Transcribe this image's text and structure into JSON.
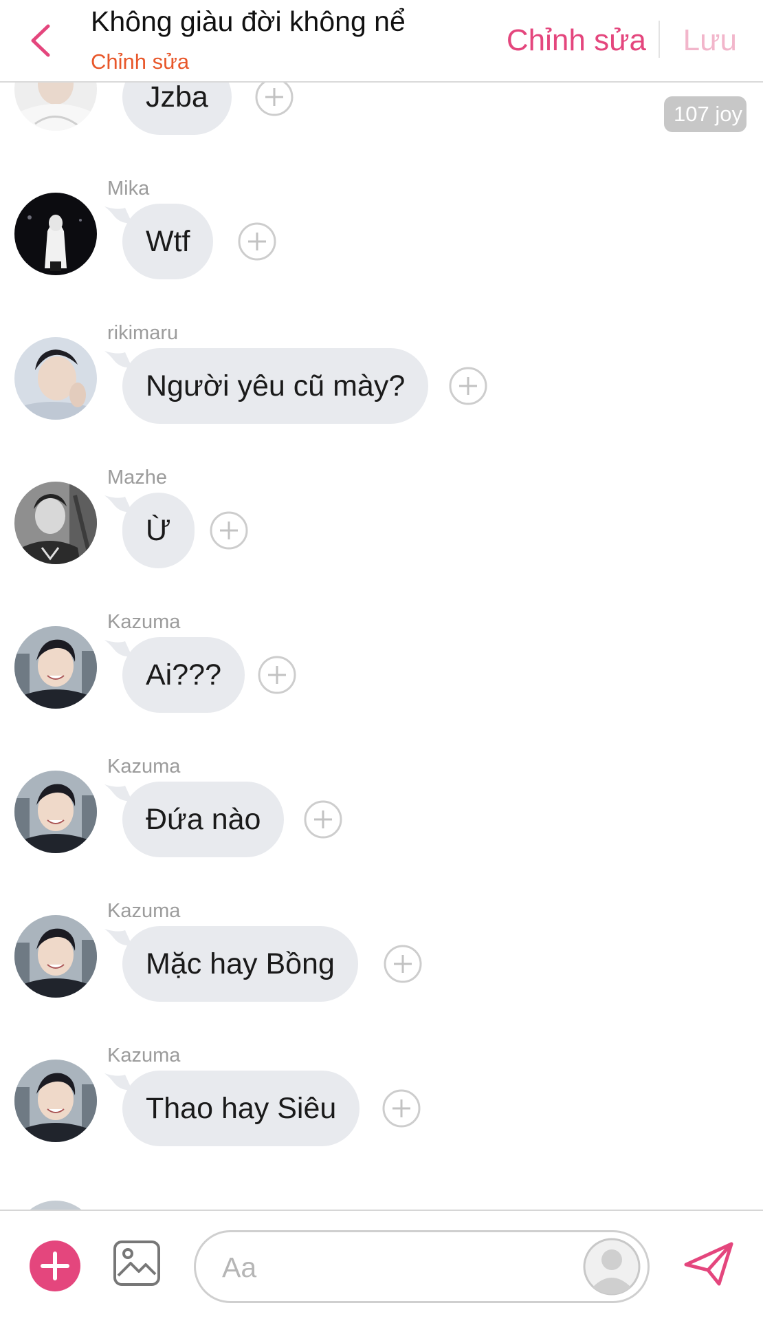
{
  "header": {
    "title": "Không giàu đời không nể",
    "subtitle": "Chỉnh sửa",
    "edit_label": "Chỉnh sửa",
    "save_label": "Lưu"
  },
  "badge": {
    "label": "107 joy"
  },
  "messages": [
    {
      "sender": "",
      "text": "Jzba",
      "avatar": "woman-white-top"
    },
    {
      "sender": "Mika",
      "text": "Wtf",
      "avatar": "hooded-figure-night"
    },
    {
      "sender": "rikimaru",
      "text": "Người yêu cũ mày?",
      "avatar": "young-man-pose"
    },
    {
      "sender": "Mazhe",
      "text": "Ừ",
      "avatar": "man-guitar-bw"
    },
    {
      "sender": "Kazuma",
      "text": "Ai???",
      "avatar": "smiling-man"
    },
    {
      "sender": "Kazuma",
      "text": "Đứa nào",
      "avatar": "smiling-man"
    },
    {
      "sender": "Kazuma",
      "text": "Mặc hay Bồng",
      "avatar": "smiling-man"
    },
    {
      "sender": "Kazuma",
      "text": "Thao hay Siêu",
      "avatar": "smiling-man"
    }
  ],
  "composer": {
    "placeholder": "Aa"
  },
  "colors": {
    "accent": "#e4467d",
    "save_disabled": "#f2b6cb",
    "subtitle": "#e8572a",
    "bubble": "#e8eaee",
    "sender_text": "#9c9c9c",
    "badge": "#c7c7c7"
  },
  "icons": {
    "back": "chevron-left-icon",
    "react": "plus-circle-icon",
    "add": "plus-icon",
    "image": "image-icon",
    "sticker": "avatar-silhouette-icon",
    "send": "paper-plane-icon"
  }
}
